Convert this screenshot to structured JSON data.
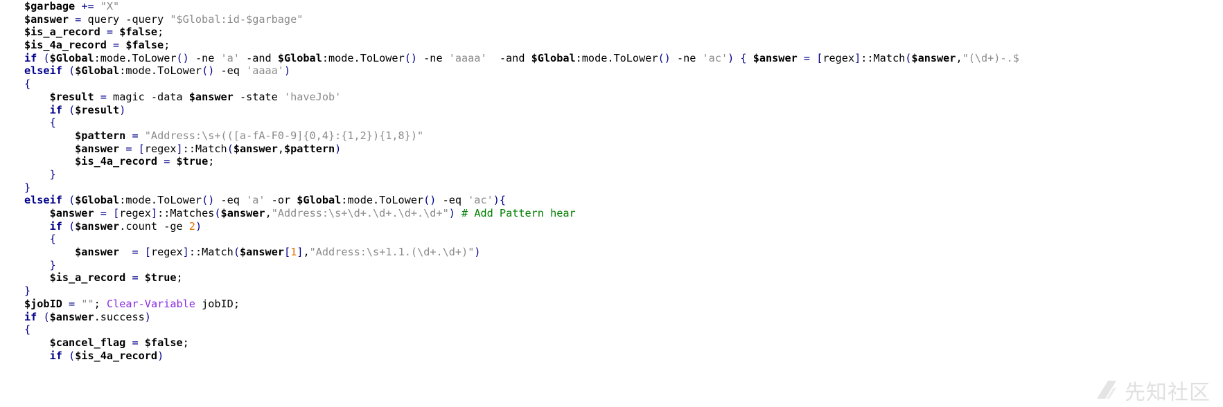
{
  "editor": {
    "lines": [
      [
        {
          "c": "v",
          "t": "$garbage"
        },
        {
          "c": "pl",
          "t": " "
        },
        {
          "c": "op",
          "t": "+="
        },
        {
          "c": "pl",
          "t": " "
        },
        {
          "c": "str",
          "t": "\"X\""
        }
      ],
      [
        {
          "c": "v",
          "t": "$answer"
        },
        {
          "c": "pl",
          "t": " "
        },
        {
          "c": "op",
          "t": "="
        },
        {
          "c": "pl",
          "t": " query -query "
        },
        {
          "c": "str",
          "t": "\"$Global:id-$garbage\""
        }
      ],
      [
        {
          "c": "v",
          "t": "$is_a_record"
        },
        {
          "c": "pl",
          "t": " "
        },
        {
          "c": "op",
          "t": "="
        },
        {
          "c": "pl",
          "t": " "
        },
        {
          "c": "v",
          "t": "$false"
        },
        {
          "c": "pl",
          "t": ";"
        }
      ],
      [
        {
          "c": "v",
          "t": "$is_4a_record"
        },
        {
          "c": "pl",
          "t": " "
        },
        {
          "c": "op",
          "t": "="
        },
        {
          "c": "pl",
          "t": " "
        },
        {
          "c": "v",
          "t": "$false"
        },
        {
          "c": "pl",
          "t": ";"
        }
      ],
      [
        {
          "c": "kw",
          "t": "if"
        },
        {
          "c": "pl",
          "t": " "
        },
        {
          "c": "br",
          "t": "("
        },
        {
          "c": "v",
          "t": "$Global"
        },
        {
          "c": "pl",
          "t": ":mode.ToLower"
        },
        {
          "c": "br",
          "t": "()"
        },
        {
          "c": "pl",
          "t": " -ne "
        },
        {
          "c": "str",
          "t": "'a'"
        },
        {
          "c": "pl",
          "t": " -and "
        },
        {
          "c": "v",
          "t": "$Global"
        },
        {
          "c": "pl",
          "t": ":mode.ToLower"
        },
        {
          "c": "br",
          "t": "()"
        },
        {
          "c": "pl",
          "t": " -ne "
        },
        {
          "c": "str",
          "t": "'aaaa'"
        },
        {
          "c": "pl",
          "t": "  -and "
        },
        {
          "c": "v",
          "t": "$Global"
        },
        {
          "c": "pl",
          "t": ":mode.ToLower"
        },
        {
          "c": "br",
          "t": "()"
        },
        {
          "c": "pl",
          "t": " -ne "
        },
        {
          "c": "str",
          "t": "'ac'"
        },
        {
          "c": "br",
          "t": ")"
        },
        {
          "c": "pl",
          "t": " "
        },
        {
          "c": "br",
          "t": "{"
        },
        {
          "c": "pl",
          "t": " "
        },
        {
          "c": "v",
          "t": "$answer"
        },
        {
          "c": "pl",
          "t": " "
        },
        {
          "c": "op",
          "t": "="
        },
        {
          "c": "pl",
          "t": " "
        },
        {
          "c": "br",
          "t": "["
        },
        {
          "c": "pl",
          "t": "regex"
        },
        {
          "c": "br",
          "t": "]"
        },
        {
          "c": "pl",
          "t": "::Match"
        },
        {
          "c": "br",
          "t": "("
        },
        {
          "c": "v",
          "t": "$answer"
        },
        {
          "c": "pl",
          "t": ","
        },
        {
          "c": "str",
          "t": "\"(\\d+)-.$"
        }
      ],
      [
        {
          "c": "kw",
          "t": "elseif"
        },
        {
          "c": "pl",
          "t": " "
        },
        {
          "c": "br",
          "t": "("
        },
        {
          "c": "v",
          "t": "$Global"
        },
        {
          "c": "pl",
          "t": ":mode.ToLower"
        },
        {
          "c": "br",
          "t": "()"
        },
        {
          "c": "pl",
          "t": " -eq "
        },
        {
          "c": "str",
          "t": "'aaaa'"
        },
        {
          "c": "br",
          "t": ")"
        }
      ],
      [
        {
          "c": "br",
          "t": "{"
        }
      ],
      [
        {
          "c": "pl",
          "t": "    "
        },
        {
          "c": "v",
          "t": "$result"
        },
        {
          "c": "pl",
          "t": " "
        },
        {
          "c": "op",
          "t": "="
        },
        {
          "c": "pl",
          "t": " magic -data "
        },
        {
          "c": "v",
          "t": "$answer"
        },
        {
          "c": "pl",
          "t": " -state "
        },
        {
          "c": "str",
          "t": "'haveJob'"
        }
      ],
      [
        {
          "c": "pl",
          "t": "    "
        },
        {
          "c": "kw",
          "t": "if"
        },
        {
          "c": "pl",
          "t": " "
        },
        {
          "c": "br",
          "t": "("
        },
        {
          "c": "v",
          "t": "$result"
        },
        {
          "c": "br",
          "t": ")"
        }
      ],
      [
        {
          "c": "pl",
          "t": "    "
        },
        {
          "c": "br",
          "t": "{"
        }
      ],
      [
        {
          "c": "pl",
          "t": "        "
        },
        {
          "c": "v",
          "t": "$pattern"
        },
        {
          "c": "pl",
          "t": " "
        },
        {
          "c": "op",
          "t": "="
        },
        {
          "c": "pl",
          "t": " "
        },
        {
          "c": "str",
          "t": "\"Address:\\s+(([a-fA-F0-9]{0,4}:{1,2}){1,8})\""
        }
      ],
      [
        {
          "c": "pl",
          "t": "        "
        },
        {
          "c": "v",
          "t": "$answer"
        },
        {
          "c": "pl",
          "t": " "
        },
        {
          "c": "op",
          "t": "="
        },
        {
          "c": "pl",
          "t": " "
        },
        {
          "c": "br",
          "t": "["
        },
        {
          "c": "pl",
          "t": "regex"
        },
        {
          "c": "br",
          "t": "]"
        },
        {
          "c": "pl",
          "t": "::Match"
        },
        {
          "c": "br",
          "t": "("
        },
        {
          "c": "v",
          "t": "$answer"
        },
        {
          "c": "pl",
          "t": ","
        },
        {
          "c": "v",
          "t": "$pattern"
        },
        {
          "c": "br",
          "t": ")"
        }
      ],
      [
        {
          "c": "pl",
          "t": "        "
        },
        {
          "c": "v",
          "t": "$is_4a_record"
        },
        {
          "c": "pl",
          "t": " "
        },
        {
          "c": "op",
          "t": "="
        },
        {
          "c": "pl",
          "t": " "
        },
        {
          "c": "v",
          "t": "$true"
        },
        {
          "c": "pl",
          "t": ";"
        }
      ],
      [
        {
          "c": "pl",
          "t": "    "
        },
        {
          "c": "br",
          "t": "}"
        }
      ],
      [
        {
          "c": "br",
          "t": "}"
        }
      ],
      [
        {
          "c": "kw",
          "t": "elseif"
        },
        {
          "c": "pl",
          "t": " "
        },
        {
          "c": "br",
          "t": "("
        },
        {
          "c": "v",
          "t": "$Global"
        },
        {
          "c": "pl",
          "t": ":mode.ToLower"
        },
        {
          "c": "br",
          "t": "()"
        },
        {
          "c": "pl",
          "t": " -eq "
        },
        {
          "c": "str",
          "t": "'a'"
        },
        {
          "c": "pl",
          "t": " -or "
        },
        {
          "c": "v",
          "t": "$Global"
        },
        {
          "c": "pl",
          "t": ":mode.ToLower"
        },
        {
          "c": "br",
          "t": "()"
        },
        {
          "c": "pl",
          "t": " -eq "
        },
        {
          "c": "str",
          "t": "'ac'"
        },
        {
          "c": "br",
          "t": "){"
        }
      ],
      [
        {
          "c": "pl",
          "t": "    "
        },
        {
          "c": "v",
          "t": "$answer"
        },
        {
          "c": "pl",
          "t": " "
        },
        {
          "c": "op",
          "t": "="
        },
        {
          "c": "pl",
          "t": " "
        },
        {
          "c": "br",
          "t": "["
        },
        {
          "c": "pl",
          "t": "regex"
        },
        {
          "c": "br",
          "t": "]"
        },
        {
          "c": "pl",
          "t": "::Matches"
        },
        {
          "c": "br",
          "t": "("
        },
        {
          "c": "v",
          "t": "$answer"
        },
        {
          "c": "pl",
          "t": ","
        },
        {
          "c": "str",
          "t": "\"Address:\\s+\\d+.\\d+.\\d+.\\d+\""
        },
        {
          "c": "br",
          "t": ")"
        },
        {
          "c": "pl",
          "t": " "
        },
        {
          "c": "cmt",
          "t": "# Add Pattern hear"
        }
      ],
      [
        {
          "c": "pl",
          "t": "    "
        },
        {
          "c": "kw",
          "t": "if"
        },
        {
          "c": "pl",
          "t": " "
        },
        {
          "c": "br",
          "t": "("
        },
        {
          "c": "v",
          "t": "$answer"
        },
        {
          "c": "pl",
          "t": ".count -ge "
        },
        {
          "c": "num",
          "t": "2"
        },
        {
          "c": "br",
          "t": ")"
        }
      ],
      [
        {
          "c": "pl",
          "t": "    "
        },
        {
          "c": "br",
          "t": "{"
        }
      ],
      [
        {
          "c": "pl",
          "t": "        "
        },
        {
          "c": "v",
          "t": "$answer"
        },
        {
          "c": "pl",
          "t": "  "
        },
        {
          "c": "op",
          "t": "="
        },
        {
          "c": "pl",
          "t": " "
        },
        {
          "c": "br",
          "t": "["
        },
        {
          "c": "pl",
          "t": "regex"
        },
        {
          "c": "br",
          "t": "]"
        },
        {
          "c": "pl",
          "t": "::Match"
        },
        {
          "c": "br",
          "t": "("
        },
        {
          "c": "v",
          "t": "$answer"
        },
        {
          "c": "br",
          "t": "["
        },
        {
          "c": "num",
          "t": "1"
        },
        {
          "c": "br",
          "t": "]"
        },
        {
          "c": "pl",
          "t": ","
        },
        {
          "c": "str",
          "t": "\"Address:\\s+1.1.(\\d+.\\d+)\""
        },
        {
          "c": "br",
          "t": ")"
        }
      ],
      [
        {
          "c": "pl",
          "t": "    "
        },
        {
          "c": "br",
          "t": "}"
        }
      ],
      [
        {
          "c": "pl",
          "t": "    "
        },
        {
          "c": "v",
          "t": "$is_a_record"
        },
        {
          "c": "pl",
          "t": " "
        },
        {
          "c": "op",
          "t": "="
        },
        {
          "c": "pl",
          "t": " "
        },
        {
          "c": "v",
          "t": "$true"
        },
        {
          "c": "pl",
          "t": ";"
        }
      ],
      [
        {
          "c": "br",
          "t": "}"
        }
      ],
      [
        {
          "c": "v",
          "t": "$jobID"
        },
        {
          "c": "pl",
          "t": " "
        },
        {
          "c": "op",
          "t": "="
        },
        {
          "c": "pl",
          "t": " "
        },
        {
          "c": "str",
          "t": "\"\""
        },
        {
          "c": "pl",
          "t": "; "
        },
        {
          "c": "cmd",
          "t": "Clear-Variable"
        },
        {
          "c": "pl",
          "t": " jobID;"
        }
      ],
      [
        {
          "c": "kw",
          "t": "if"
        },
        {
          "c": "pl",
          "t": " "
        },
        {
          "c": "br",
          "t": "("
        },
        {
          "c": "v",
          "t": "$answer"
        },
        {
          "c": "pl",
          "t": ".success"
        },
        {
          "c": "br",
          "t": ")"
        }
      ],
      [
        {
          "c": "br",
          "t": "{"
        }
      ],
      [
        {
          "c": "pl",
          "t": "    "
        },
        {
          "c": "v",
          "t": "$cancel_flag"
        },
        {
          "c": "pl",
          "t": " "
        },
        {
          "c": "op",
          "t": "="
        },
        {
          "c": "pl",
          "t": " "
        },
        {
          "c": "v",
          "t": "$false"
        },
        {
          "c": "pl",
          "t": ";"
        }
      ],
      [
        {
          "c": "pl",
          "t": "    "
        },
        {
          "c": "kw",
          "t": "if"
        },
        {
          "c": "pl",
          "t": " "
        },
        {
          "c": "br",
          "t": "("
        },
        {
          "c": "v",
          "t": "$is_4a_record"
        },
        {
          "c": "br",
          "t": ")"
        }
      ]
    ]
  },
  "watermark": {
    "text": "先知社区",
    "icon": "xianzhi-logo-icon"
  }
}
